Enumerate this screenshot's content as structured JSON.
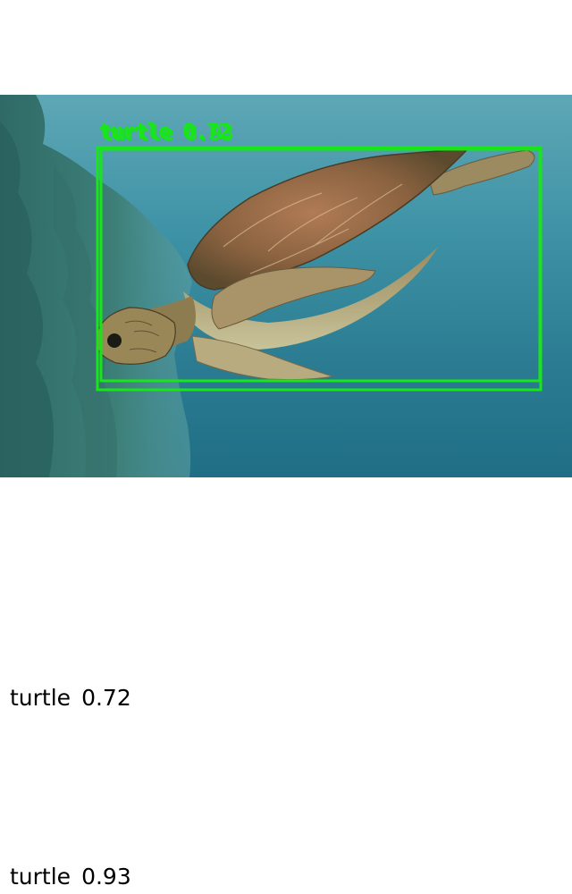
{
  "detections": [
    {
      "label": "turtle",
      "score": "0.72"
    },
    {
      "label": "turtle",
      "score": "0.93"
    }
  ],
  "overlay_text": {
    "first": "turtle 0.72",
    "second": "turtle 0.93"
  },
  "colors": {
    "box": "#19e619",
    "text": "#000000",
    "background": "#ffffff",
    "water": "#3f93a6"
  }
}
